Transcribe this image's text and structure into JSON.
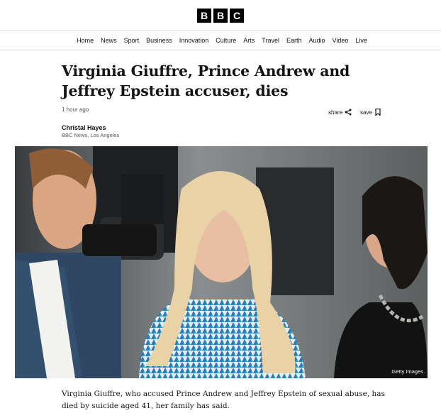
{
  "logo": {
    "letters": [
      "B",
      "B",
      "C"
    ]
  },
  "nav": {
    "items": [
      {
        "label": "Home",
        "name": "home"
      },
      {
        "label": "News",
        "name": "news"
      },
      {
        "label": "Sport",
        "name": "sport"
      },
      {
        "label": "Business",
        "name": "business"
      },
      {
        "label": "Innovation",
        "name": "innovation"
      },
      {
        "label": "Culture",
        "name": "culture"
      },
      {
        "label": "Arts",
        "name": "arts"
      },
      {
        "label": "Travel",
        "name": "travel"
      },
      {
        "label": "Earth",
        "name": "earth"
      },
      {
        "label": "Audio",
        "name": "audio"
      },
      {
        "label": "Video",
        "name": "video"
      },
      {
        "label": "Live",
        "name": "live"
      }
    ]
  },
  "article": {
    "headline": "Virginia Giuffre, Prince Andrew and Jeffrey Epstein accuser, dies",
    "timestamp": "1 hour ago",
    "share_label": "share",
    "save_label": "save",
    "author": "Christal Hayes",
    "author_role": "BBC News, Los Angeles",
    "image_credit": "Getty Images",
    "summary": "Virginia Giuffre, who accused Prince Andrew and Jeffrey Epstein of sexual abuse, has died by suicide aged 41, her family has said."
  },
  "icons": {
    "share": "share-icon",
    "save": "bookmark-icon"
  }
}
